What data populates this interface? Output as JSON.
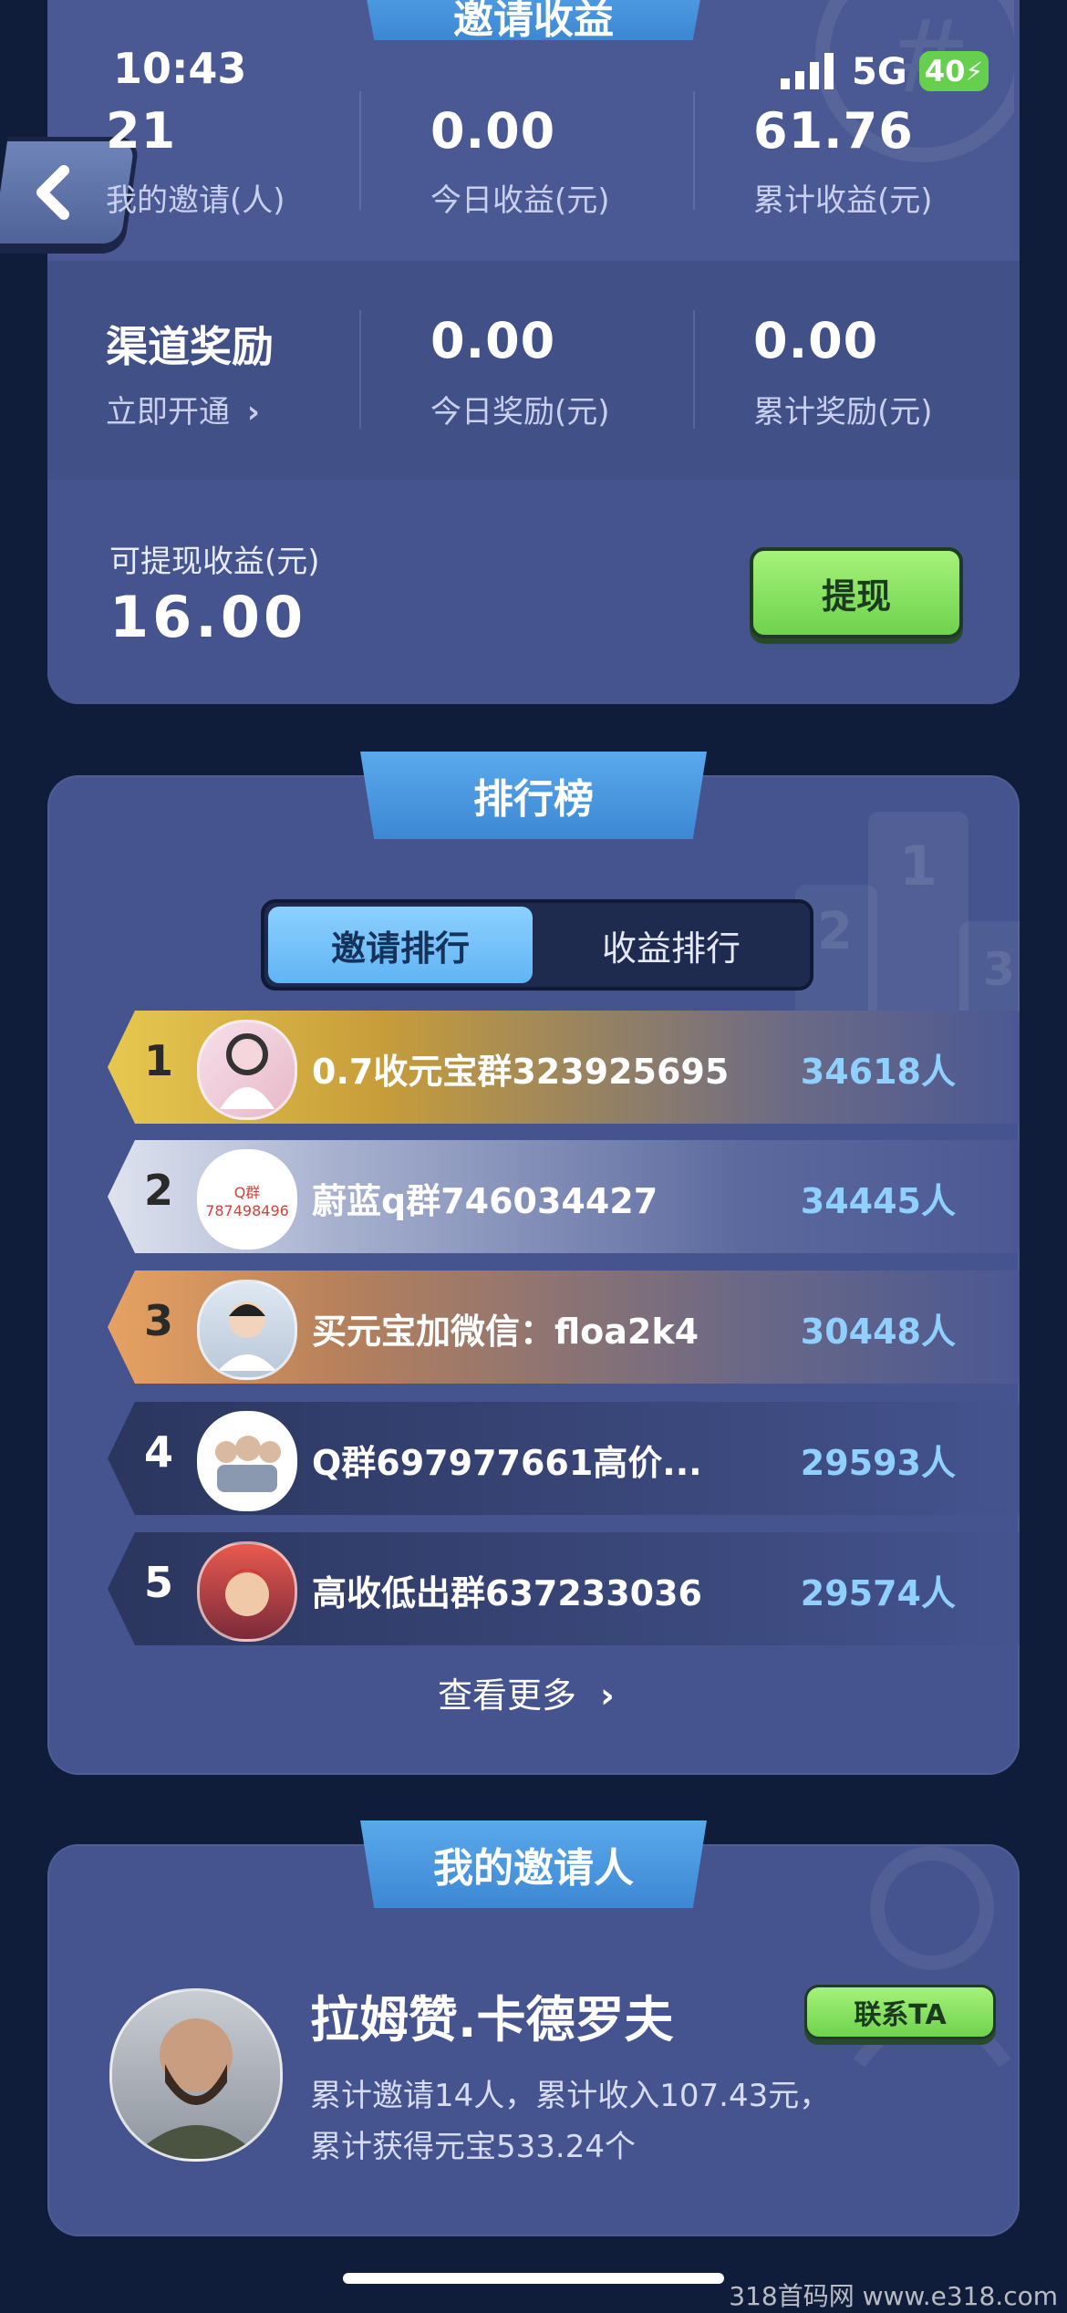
{
  "status_bar": {
    "time": "10:43",
    "network": "5G",
    "battery": "40"
  },
  "earnings": {
    "section_title": "邀请收益",
    "my_invites_value": "21",
    "my_invites_label": "我的邀请(人)",
    "today_earnings_value": "0.00",
    "today_earnings_label": "今日收益(元)",
    "total_earnings_value": "61.76",
    "total_earnings_label": "累计收益(元)",
    "channel_title": "渠道奖励",
    "channel_link": "立即开通",
    "today_reward_value": "0.00",
    "today_reward_label": "今日奖励(元)",
    "total_reward_value": "0.00",
    "total_reward_label": "累计奖励(元)",
    "withdrawable_label": "可提现收益(元)",
    "withdrawable_value": "16.00",
    "withdraw_button": "提现"
  },
  "leaderboard": {
    "title": "排行榜",
    "tab_invite": "邀请排行",
    "tab_earnings": "收益排行",
    "rows": [
      {
        "rank": "1",
        "name": "0.7收元宝群323925695",
        "count": "34618人"
      },
      {
        "rank": "2",
        "name": "蔚蓝q群746034427",
        "count": "34445人",
        "avatar_text_1": "Q群",
        "avatar_text_2": "787498496"
      },
      {
        "rank": "3",
        "name": "买元宝加微信：floa2k4",
        "count": "30448人"
      },
      {
        "rank": "4",
        "name": "Q群697977661高价...",
        "count": "29593人"
      },
      {
        "rank": "5",
        "name": "高收低出群637233036",
        "count": "29574人"
      }
    ],
    "see_more": "查看更多"
  },
  "inviter": {
    "title": "我的邀请人",
    "name": "拉姆赞.卡德罗夫",
    "contact_button": "联系TA",
    "desc_line1": "累计邀请14人，累计收入107.43元，",
    "desc_line2": "累计获得元宝533.24个"
  },
  "watermark": "318首码网 www.e318.com",
  "colors": {
    "accent_blue": "#4a97e0",
    "green_button": "#8de464",
    "card_bg": "#45538f",
    "page_bg": "#0f1c3a"
  }
}
